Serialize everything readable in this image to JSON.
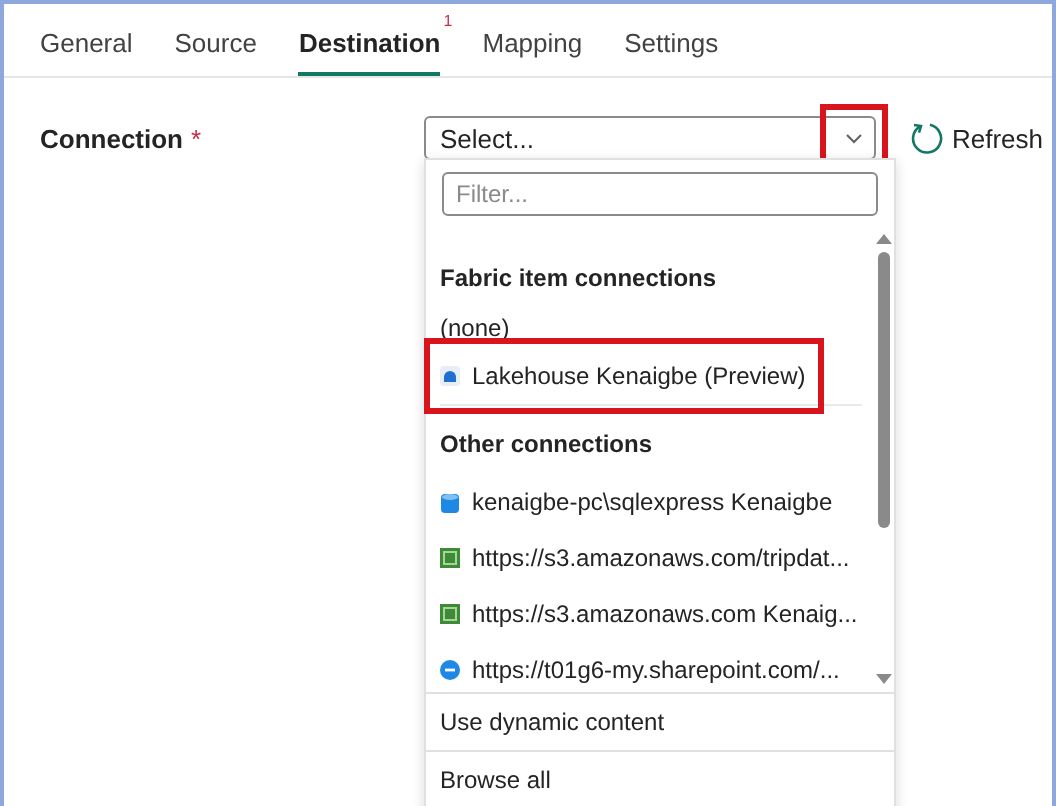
{
  "tabs": [
    {
      "label": "General",
      "selected": false
    },
    {
      "label": "Source",
      "selected": false
    },
    {
      "label": "Destination",
      "selected": true,
      "badge": "1"
    },
    {
      "label": "Mapping",
      "selected": false
    },
    {
      "label": "Settings",
      "selected": false
    }
  ],
  "connection": {
    "label": "Connection",
    "required_mark": "*",
    "value": "Select...",
    "chevron_highlighted": true,
    "refresh": "Refresh"
  },
  "dropdown": {
    "filter_placeholder": "Filter...",
    "sections": [
      {
        "header": "Fabric item connections",
        "items": [
          {
            "kind": "none",
            "label": "(none)",
            "highlighted": false
          },
          {
            "kind": "lakehouse",
            "label": "Lakehouse Kenaigbe (Preview)",
            "highlighted": true
          }
        ]
      },
      {
        "header": "Other connections",
        "items": [
          {
            "kind": "sql",
            "label": "kenaigbe-pc\\sqlexpress Kenaigbe",
            "highlighted": false
          },
          {
            "kind": "s3",
            "label": "https://s3.amazonaws.com/tripdat...",
            "highlighted": false
          },
          {
            "kind": "s3",
            "label": "https://s3.amazonaws.com Kenaig...",
            "highlighted": false
          },
          {
            "kind": "sharepoint",
            "label": "https://t01g6-my.sharepoint.com/...",
            "highlighted": false
          }
        ]
      }
    ],
    "footer": [
      "Use dynamic content",
      "Browse all"
    ]
  }
}
